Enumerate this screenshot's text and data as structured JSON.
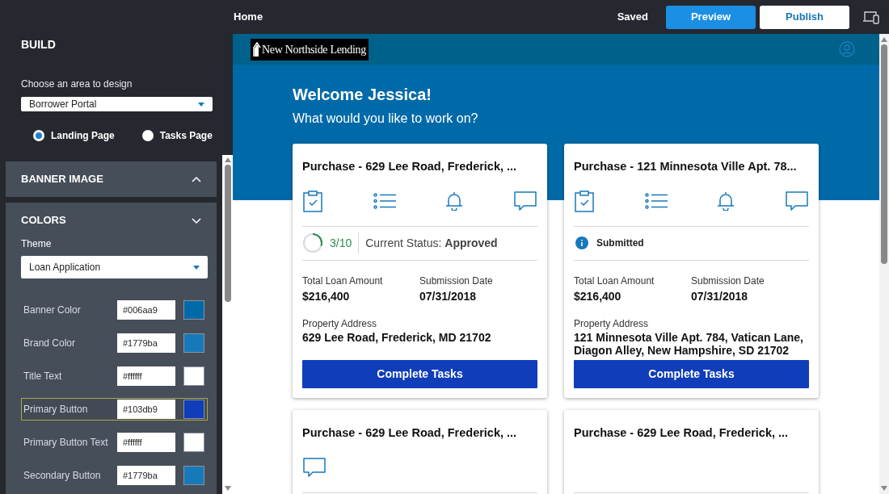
{
  "sidebar": {
    "title": "BUILD",
    "area_label": "Choose an area to design",
    "area_select": {
      "value": "Borrower Portal"
    },
    "page_options": [
      {
        "label": "Landing Page",
        "selected": true
      },
      {
        "label": "Tasks Page",
        "selected": false
      }
    ],
    "sections": [
      {
        "title": "BANNER IMAGE",
        "expanded": false
      },
      {
        "title": "COLORS",
        "expanded": true,
        "theme_label": "Theme",
        "theme_select": {
          "value": "Loan Application"
        },
        "colors": [
          {
            "label": "Banner Color",
            "value": "#006aa9",
            "color": "#006aa9",
            "selected": false
          },
          {
            "label": "Brand Color",
            "value": "#1779ba",
            "color": "#1779ba",
            "selected": false
          },
          {
            "label": "Title Text",
            "value": "#ffffff",
            "color": "#ffffff",
            "selected": false
          },
          {
            "label": "Primary Button",
            "value": "#103db9",
            "color": "#103db9",
            "selected": true
          },
          {
            "label": "Primary Button Text",
            "value": "#ffffff",
            "color": "#ffffff",
            "selected": false
          },
          {
            "label": "Secondary Button",
            "value": "#1779ba",
            "color": "#1779ba",
            "selected": false
          }
        ]
      }
    ]
  },
  "toolbar": {
    "page": "Home",
    "save_state": "Saved",
    "buttons": [
      {
        "label": "Preview",
        "kind": "primary"
      },
      {
        "label": "Publish",
        "kind": "secondary"
      }
    ]
  },
  "preview": {
    "logo": "New Northside Lending",
    "welcome": "Welcome Jessica!",
    "subtitle": "What would you like to work on?",
    "cards": [
      {
        "title": "Purchase - 629 Lee Road, Frederick, ...",
        "actions": [
          {
            "kind": "tasks"
          },
          {
            "kind": "checklist"
          },
          {
            "kind": "alerts"
          },
          {
            "kind": "messages"
          }
        ],
        "status": {
          "kind": "progress",
          "level": 0.3,
          "reading": "3/10",
          "text": "Current Status: **Approved**"
        },
        "fields": [
          {
            "label": "Total Loan Amount",
            "value": "$216,400"
          },
          {
            "label": "Submission Date",
            "value": "07/31/2018"
          }
        ],
        "address": {
          "label": "Property Address",
          "value": "629 Lee Road, Frederick, MD 21702"
        },
        "button": "Complete Tasks"
      },
      {
        "title": "Purchase - 121 Minnesota Ville Apt. 78...",
        "actions": [
          {
            "kind": "tasks"
          },
          {
            "kind": "checklist"
          },
          {
            "kind": "alerts"
          },
          {
            "kind": "messages"
          }
        ],
        "status": {
          "kind": "info",
          "text": "Submitted"
        },
        "fields": [
          {
            "label": "Total Loan Amount",
            "value": "$216,400"
          },
          {
            "label": "Submission Date",
            "value": "07/31/2018"
          }
        ],
        "address": {
          "label": "Property Address",
          "value": "121 Minnesota Ville Apt. 784, Vatican Lane, Diagon Alley, New Hampshire, SD 21702"
        },
        "button": "Complete Tasks"
      },
      {
        "title": "Purchase - 629 Lee Road, Frederick, ...",
        "actions": [
          {
            "kind": "messages"
          }
        ]
      },
      {
        "title": "Purchase - 629 Lee Road, Frederick, ..."
      }
    ]
  }
}
